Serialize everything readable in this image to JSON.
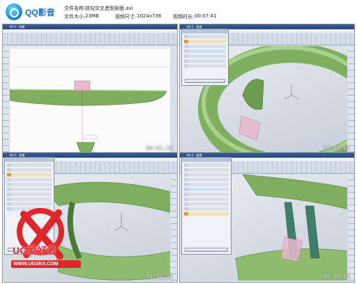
{
  "app": {
    "name": "QQ影音",
    "logo_icon": "qq-player-logo-icon"
  },
  "file_info": {
    "name_label": "文件名称:",
    "name_value": "挂勾交叉造型剖面.avi",
    "size_label": "文件大小:",
    "size_value": "23MB",
    "dim_label": "视频尺寸:",
    "dim_value": "1024x736",
    "dur_label": "视频时长:",
    "dur_value": "00:07:41"
  },
  "thumbnails": [
    {
      "timestamp": "00:01:32",
      "title": "NX 6 - 建模"
    },
    {
      "timestamp": "00:03:04",
      "title": "NX 6 - 建模"
    },
    {
      "timestamp": "00:04:36",
      "title": "NX 6 - 建模"
    },
    {
      "timestamp": "00:06:08",
      "title": "NX 6 - 建模"
    }
  ],
  "watermark": {
    "brand": "UG爱好者",
    "url": "WWW.UGSNX.COM"
  },
  "colors": {
    "model_green": "#7fae5f",
    "accent_orange": "#e59b34",
    "title_blue": "#2a4674",
    "watermark_red": "#e0262b"
  }
}
